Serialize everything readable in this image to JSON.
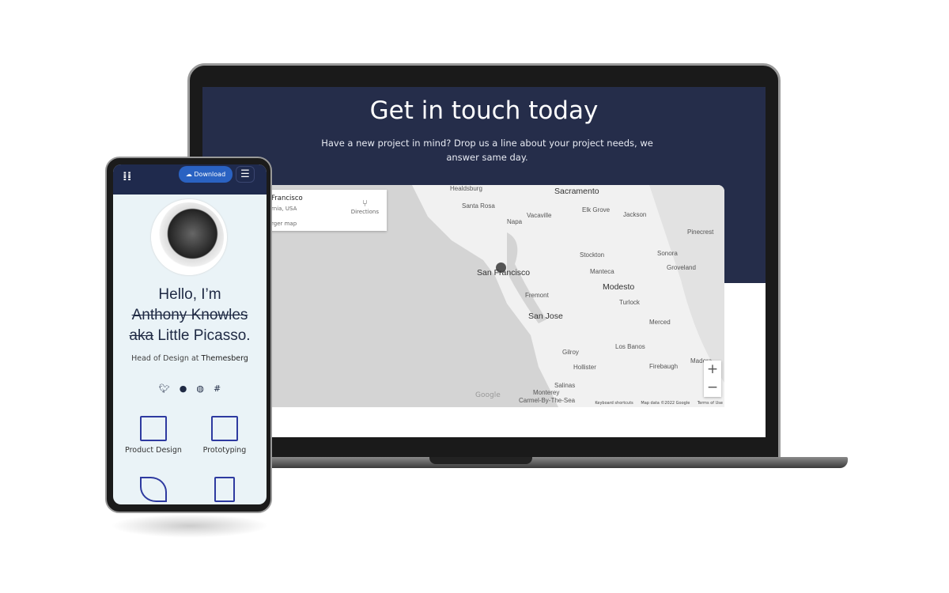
{
  "laptop": {
    "hero": {
      "title": "Get in touch today",
      "subtitle": "Have a new project in mind? Drop us a line about your project needs, we answer same day."
    },
    "map": {
      "info_title": "Francisco",
      "info_subtitle": "rnia, USA",
      "info_link": "rger map",
      "directions": "Directions",
      "cities": [
        "Sacramento",
        "Santa Rosa",
        "Healdsburg",
        "Napa",
        "Vacaville",
        "Elk Grove",
        "Jackson",
        "Pinecrest",
        "Stockton",
        "Sonora",
        "Groveland",
        "San Francisco",
        "Manteca",
        "Modesto",
        "Fremont",
        "Turlock",
        "San Jose",
        "Merced",
        "Gilroy",
        "Los Banos",
        "Hollister",
        "Firebaugh",
        "Madera",
        "Salinas",
        "Monterey",
        "Carmel-By-The-Sea"
      ],
      "google": "Google",
      "zoom_in": "+",
      "zoom_out": "−",
      "footer": [
        "Keyboard shortcuts",
        "Map data ©2022 Google",
        "Terms of Use"
      ]
    }
  },
  "phone": {
    "download": "Download",
    "menu_icon": "☰",
    "hello": "Hello, I’m",
    "name": "Anthony Knowles",
    "aka": "aka",
    "alias": "Little Picasso.",
    "role": "Head of Design at",
    "company": "Themesberg",
    "social": [
      "twitter-icon",
      "github-icon",
      "dribbble-icon",
      "slack-icon"
    ],
    "services": [
      "Product Design",
      "Prototyping"
    ]
  },
  "colors": {
    "navy": "#252d4a",
    "accent": "#2a62c2",
    "phone_bg": "#eaf3f7"
  }
}
